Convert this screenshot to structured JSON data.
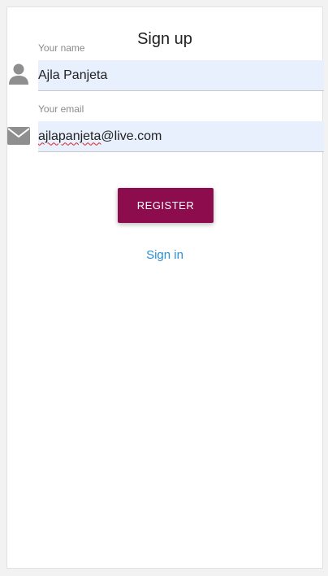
{
  "form": {
    "title": "Sign up",
    "name_field": {
      "label": "Your name",
      "value": "Ajla Panjeta",
      "icon": "person-icon"
    },
    "email_field": {
      "label": "Your email",
      "value_misspelled_part": "ajlapanjeta",
      "value_rest": "@live.com",
      "icon": "envelope-icon"
    },
    "register_label": "REGISTER",
    "signin_label": "Sign in"
  },
  "colors": {
    "primary_button": "#8c0c4e",
    "link": "#2a8fd4",
    "input_autofill_bg": "#e8f0fe",
    "icon_gray": "#8f8f8f"
  }
}
